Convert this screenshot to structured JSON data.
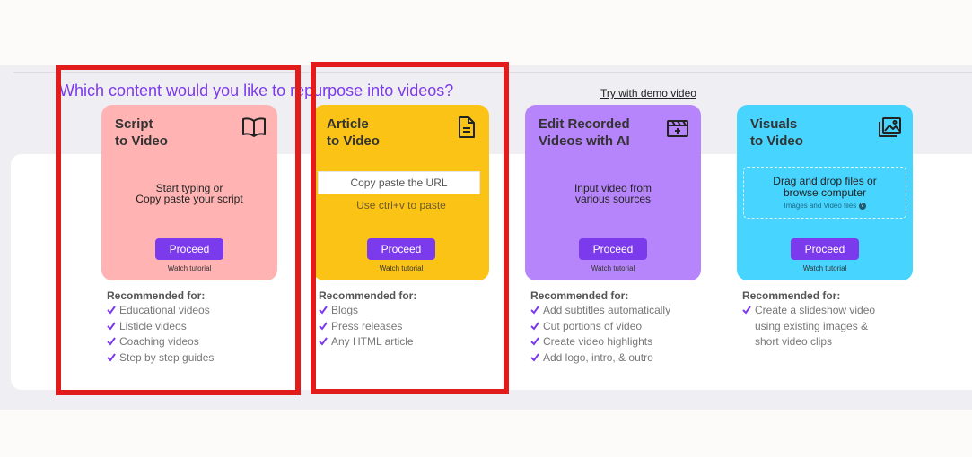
{
  "heading": "Which content would you like to repurpose into videos?",
  "demo_link": "Try with demo video",
  "colors": {
    "accent": "#7c3aed",
    "highlight": "#e21b1b"
  },
  "cards": [
    {
      "title_line1": "Script",
      "title_line2": "to Video",
      "icon": "open-book-icon",
      "bg": "#ffb3b3",
      "body_line1": "Start typing or",
      "body_line2": "Copy paste your script",
      "proceed": "Proceed",
      "watch": "Watch tutorial"
    },
    {
      "title_line1": "Article",
      "title_line2": "to Video",
      "icon": "document-icon",
      "bg": "#fbc315",
      "input_placeholder": "Copy paste the URL",
      "hint": "Use ctrl+v to paste",
      "proceed": "Proceed",
      "watch": "Watch tutorial"
    },
    {
      "title_line1": "Edit Recorded",
      "title_line2": "Videos with AI",
      "icon": "video-edit-icon",
      "bg": "#b785fb",
      "body_line1": "Input video from",
      "body_line2": "various sources",
      "proceed": "Proceed",
      "watch": "Watch tutorial"
    },
    {
      "title_line1": "Visuals",
      "title_line2": "to Video",
      "icon": "image-gallery-icon",
      "bg": "#47d4ff",
      "drop_line1": "Drag and drop files or",
      "drop_line2": "browse computer",
      "drop_sub": "Images and Video files",
      "proceed": "Proceed",
      "watch": "Watch tutorial"
    }
  ],
  "recommended": [
    {
      "title": "Recommended for:",
      "items": [
        "Educational videos",
        "Listicle videos",
        "Coaching videos",
        "Step by step guides"
      ]
    },
    {
      "title": "Recommended for:",
      "items": [
        "Blogs",
        "Press releases",
        "Any HTML article"
      ]
    },
    {
      "title": "Recommended for:",
      "items": [
        "Add subtitles automatically",
        "Cut portions of video",
        "Create video highlights",
        "Add logo, intro, & outro"
      ]
    },
    {
      "title": "Recommended for:",
      "items": [
        "Create a slideshow video",
        "using existing images &",
        "short video clips"
      ]
    }
  ]
}
